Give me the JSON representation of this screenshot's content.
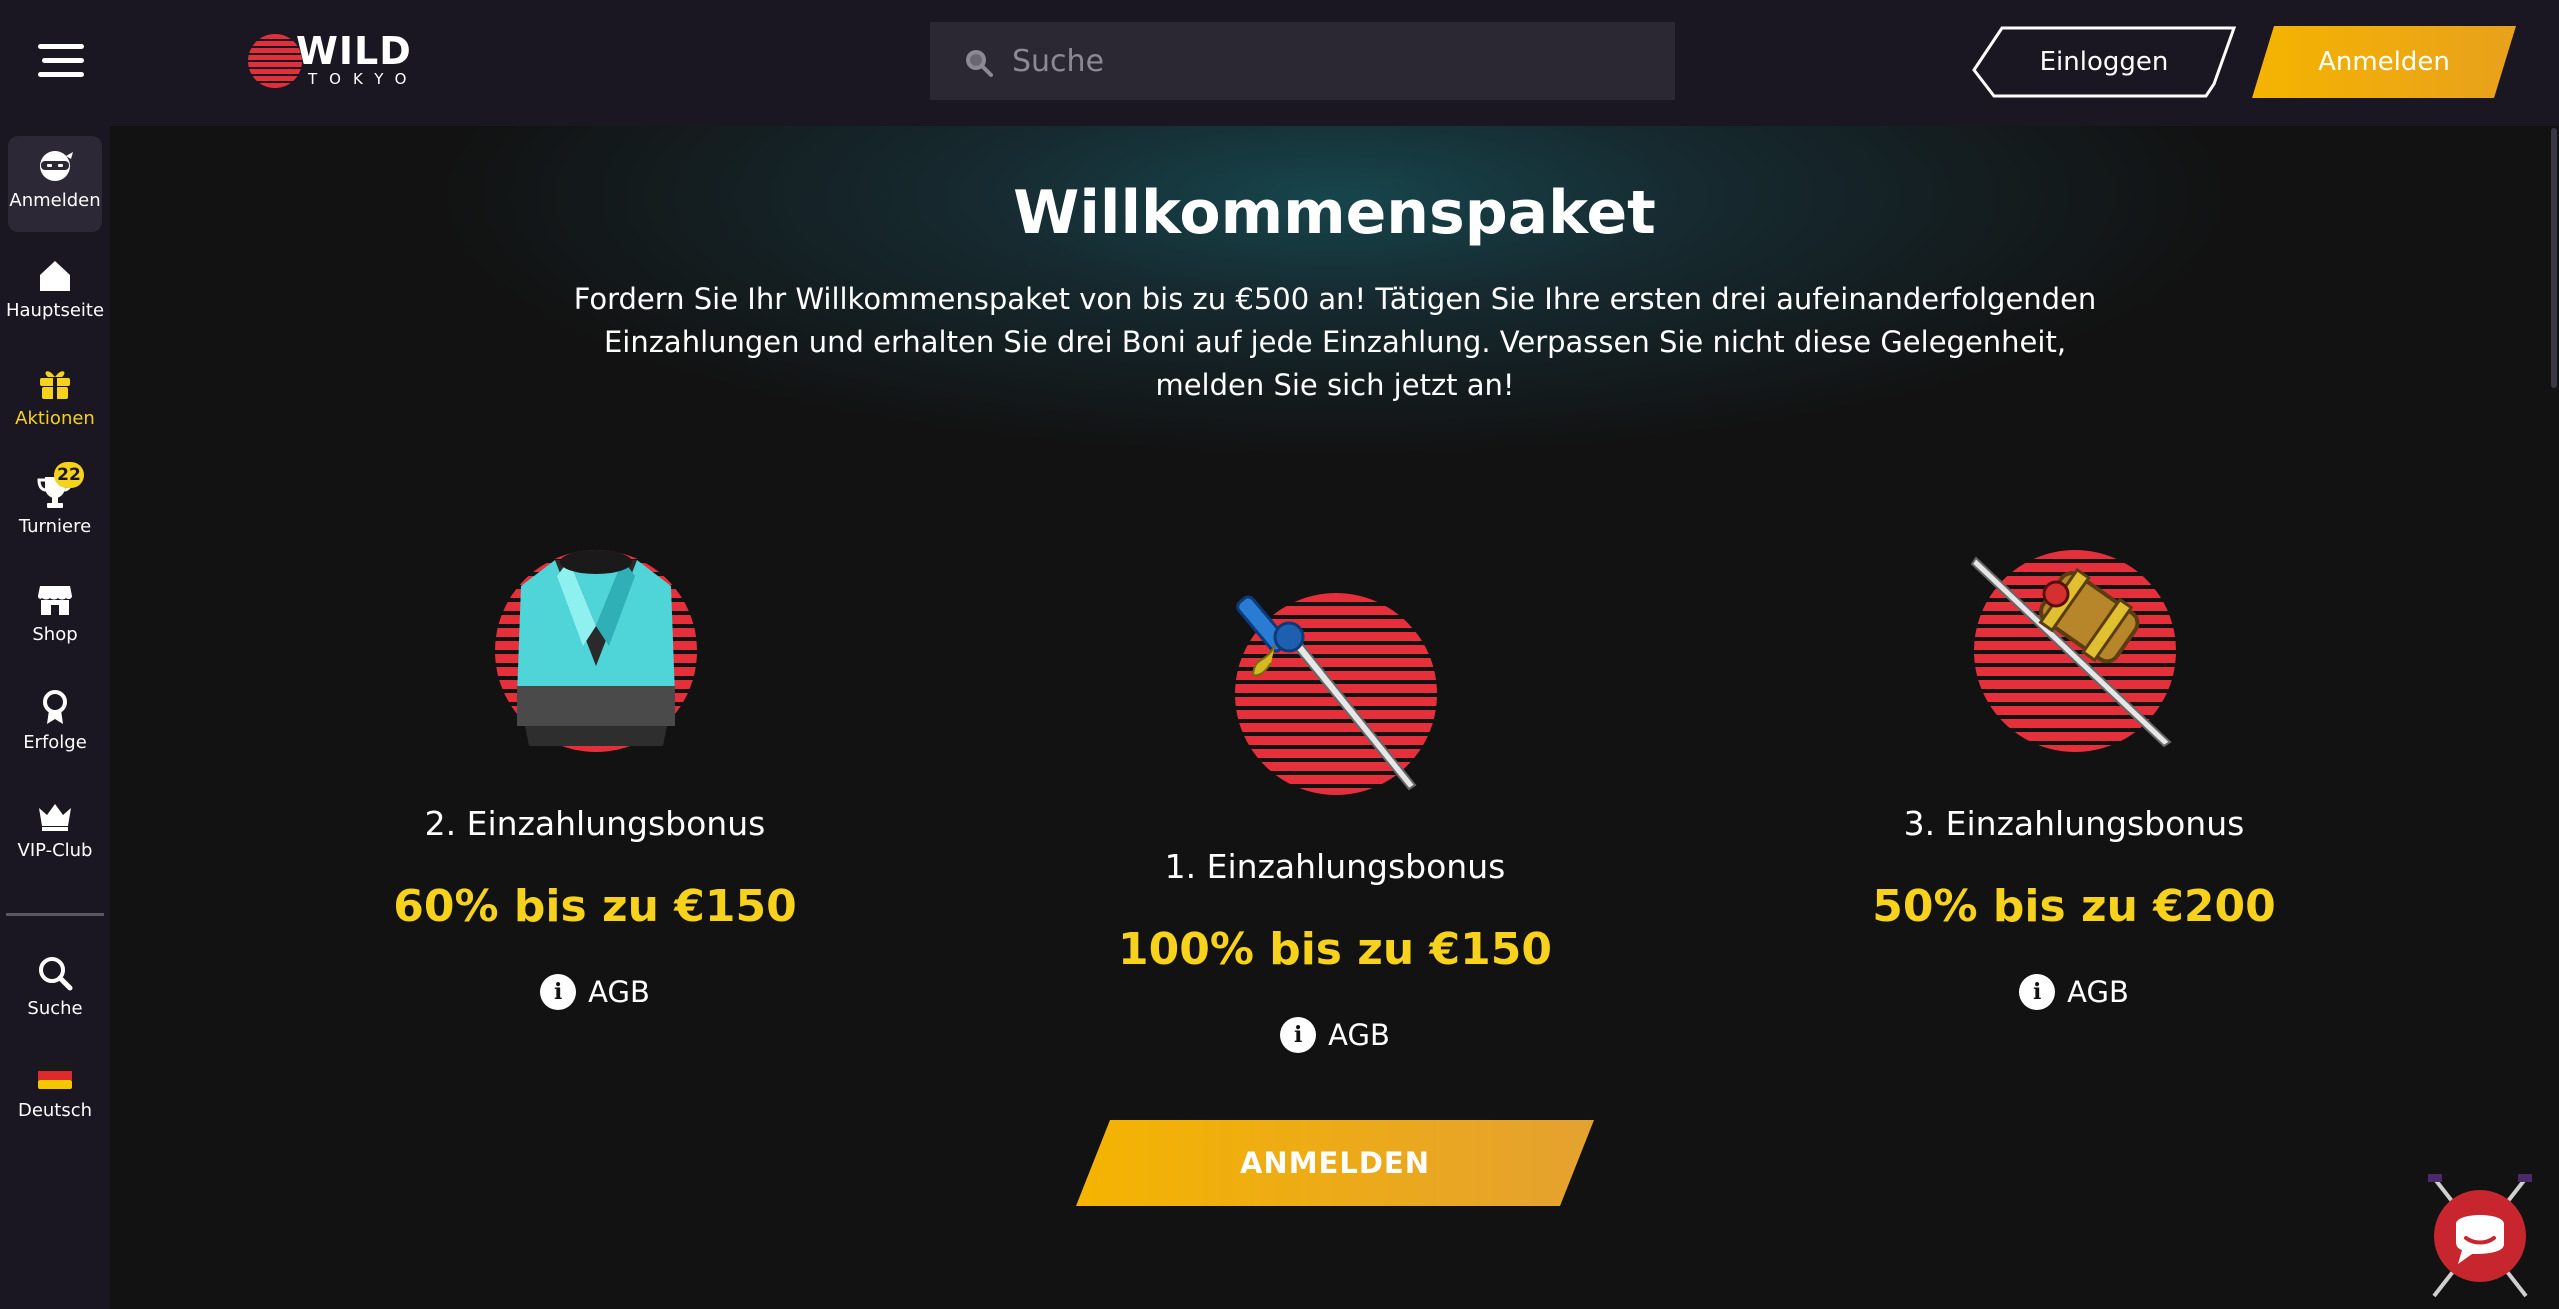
{
  "header": {
    "logo_word": "WILD",
    "logo_sub": "TOKYO",
    "search_placeholder": "Suche",
    "login_label": "Einloggen",
    "register_label": "Anmelden"
  },
  "sidebar": {
    "items": [
      {
        "label": "Anmelden",
        "icon": "ninja-icon"
      },
      {
        "label": "Hauptseite",
        "icon": "home-icon"
      },
      {
        "label": "Aktionen",
        "icon": "gift-icon"
      },
      {
        "label": "Turniere",
        "icon": "trophy-icon",
        "badge": "22"
      },
      {
        "label": "Shop",
        "icon": "shop-icon"
      },
      {
        "label": "Erfolge",
        "icon": "medal-icon"
      },
      {
        "label": "VIP-Club",
        "icon": "crown-icon"
      },
      {
        "label": "Suche",
        "icon": "search-icon"
      },
      {
        "label": "Deutsch",
        "icon": "germany-flag-icon"
      }
    ]
  },
  "main": {
    "title": "Willkommenspaket",
    "description": "Fordern Sie Ihr Willkommenspaket von bis zu €500 an! Tätigen Sie Ihre ersten drei aufeinanderfolgenden Einzahlungen und erhalten Sie drei Boni auf jede Einzahlung. Verpassen Sie nicht diese Gelegenheit, melden Sie sich jetzt an!",
    "bonuses": [
      {
        "name": "2. Einzahlungsbonus",
        "value": "60% bis zu €150",
        "terms": "AGB",
        "icon": "kimono-icon"
      },
      {
        "name": "1. Einzahlungsbonus",
        "value": "100% bis zu €150",
        "terms": "AGB",
        "icon": "katana-icon"
      },
      {
        "name": "3. Einzahlungsbonus",
        "value": "50% bis zu €200",
        "terms": "AGB",
        "icon": "sword-hammer-icon"
      }
    ],
    "cta_label": "ANMELDEN"
  },
  "colors": {
    "accent_yellow": "#f6d21c",
    "button_orange": "#f5b400",
    "header_bg": "#1b1722",
    "page_bg": "#121212",
    "sun_red": "#e5303c"
  }
}
